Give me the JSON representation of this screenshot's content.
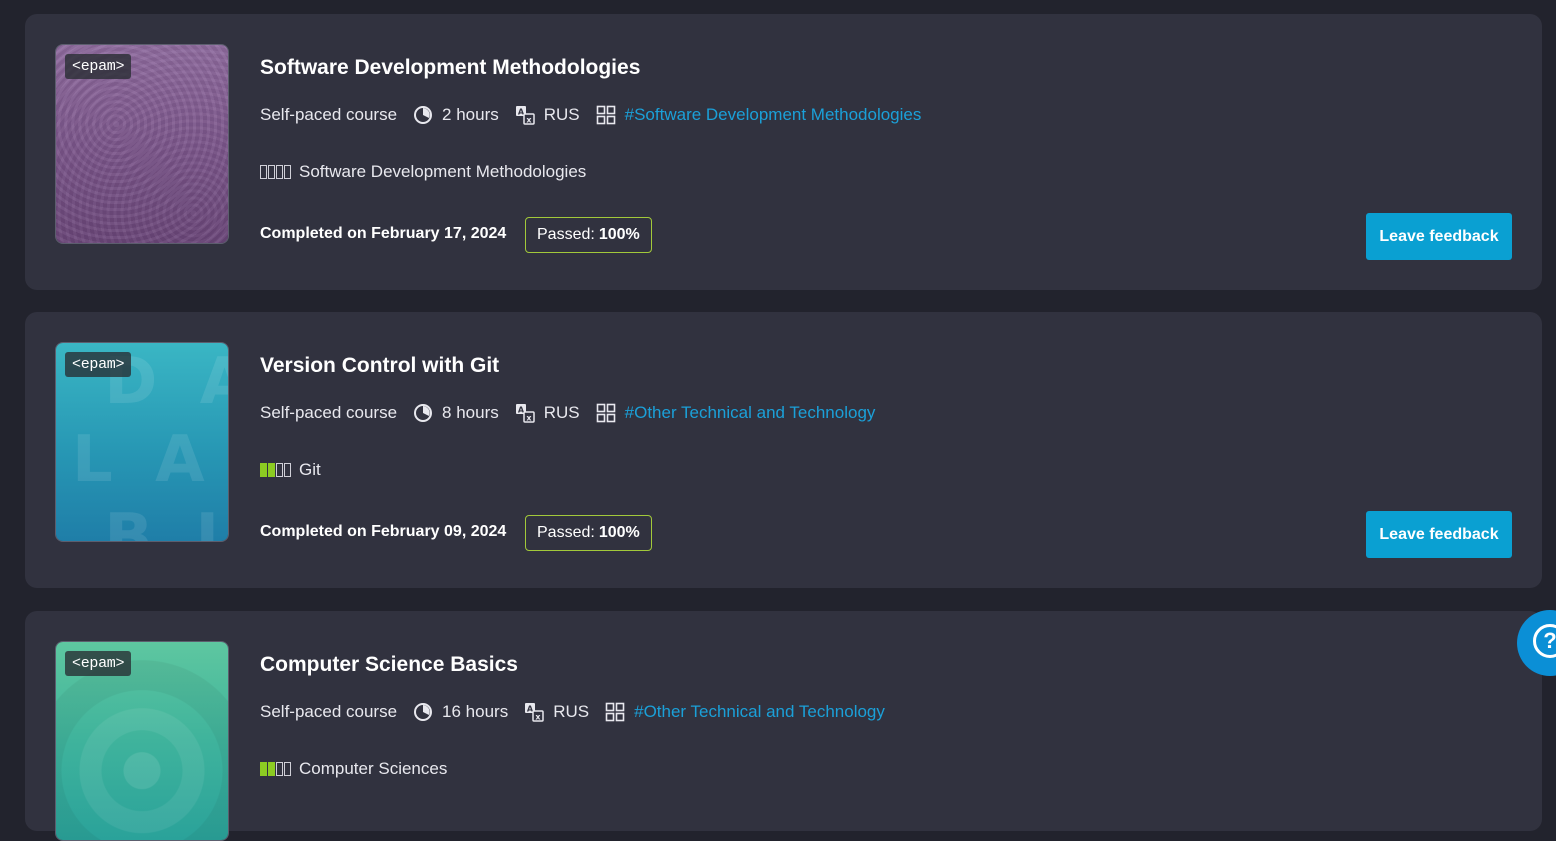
{
  "brand_badge": "<epam>",
  "courses": [
    {
      "title": "Software Development Methodologies",
      "type": "Self-paced course",
      "duration": "2 hours",
      "language": "RUS",
      "tag": "#Software Development Methodologies",
      "skill_name": "Software Development Methodologies",
      "skill_level": 0,
      "completed": "Completed on February 17, 2024",
      "passed_label": "Passed:",
      "passed_value": "100%",
      "feedback_label": "Leave feedback",
      "thumbnail": "purple-swirl-pattern"
    },
    {
      "title": "Version Control with Git",
      "type": "Self-paced course",
      "duration": "8 hours",
      "language": "RUS",
      "tag": "#Other Technical and Technology",
      "skill_name": "Git",
      "skill_level": 2,
      "completed": "Completed on February 09, 2024",
      "passed_label": "Passed:",
      "passed_value": "100%",
      "feedback_label": "Leave feedback",
      "thumbnail": "teal-letters-pattern"
    },
    {
      "title": "Computer Science Basics",
      "type": "Self-paced course",
      "duration": "16 hours",
      "language": "RUS",
      "tag": "#Other Technical and Technology",
      "skill_name": "Computer Sciences",
      "skill_level": 2,
      "thumbnail": "green-spiral-pattern"
    }
  ],
  "colors": {
    "page_bg": "#22232d",
    "card_bg": "#31323f",
    "accent": "#0aa0d2",
    "tag_link": "#1ba0d8",
    "skill_on": "#8ccc22",
    "passed_border": "#a2c93a"
  },
  "help_button": {
    "icon": "question-mark-icon"
  }
}
